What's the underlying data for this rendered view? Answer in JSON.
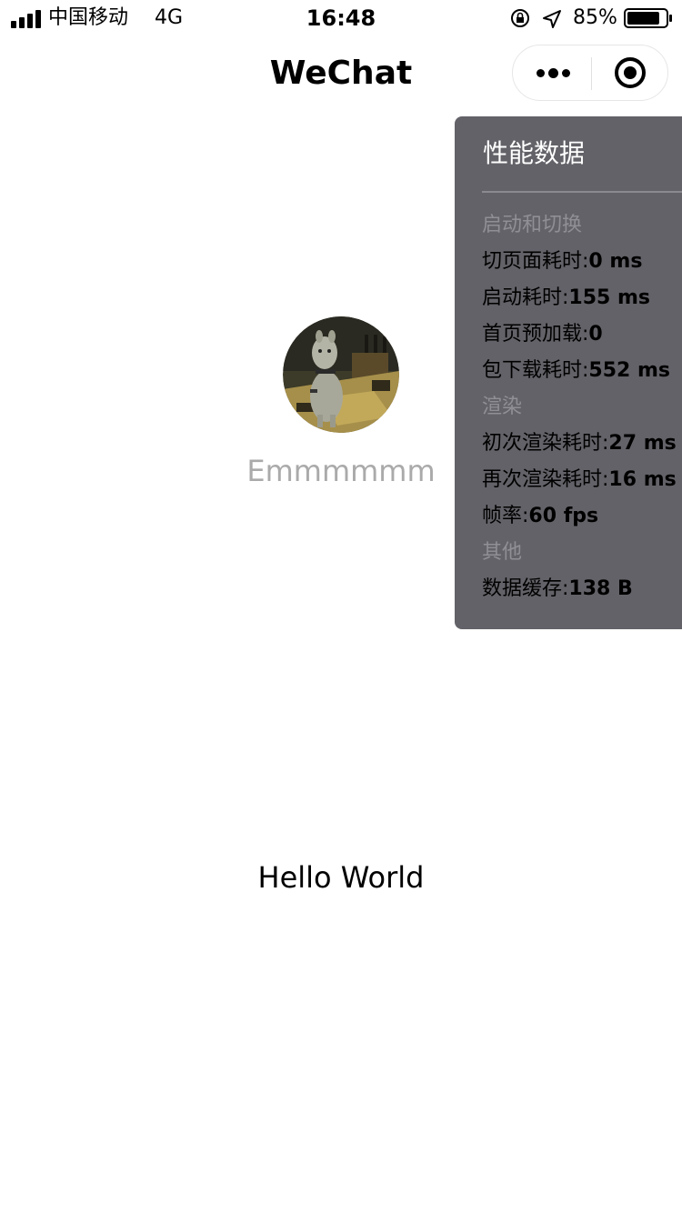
{
  "status_bar": {
    "carrier": "中国移动",
    "network": "4G",
    "time": "16:48",
    "battery_percent": "85%",
    "battery_level": 0.85,
    "icons": [
      "signal-icon",
      "lock-rotation-icon",
      "location-arrow-icon",
      "battery-icon"
    ]
  },
  "nav": {
    "title": "WeChat",
    "more_icon": "more-dots-icon",
    "close_icon": "target-circle-icon"
  },
  "profile": {
    "nickname": "Emmmmmm",
    "avatar": "avatar-image"
  },
  "main": {
    "greeting": "Hello World"
  },
  "perf_panel": {
    "title": "性能数据",
    "sections": [
      {
        "name": "启动和切换",
        "rows": [
          {
            "label": "切页面耗时:",
            "value": "0 ms"
          },
          {
            "label": "启动耗时:",
            "value": "155 ms"
          },
          {
            "label": "首页预加载:",
            "value": "0"
          },
          {
            "label": "包下载耗时:",
            "value": "552 ms"
          }
        ]
      },
      {
        "name": "渲染",
        "rows": [
          {
            "label": "初次渲染耗时:",
            "value": "27 ms"
          },
          {
            "label": "再次渲染耗时:",
            "value": "16 ms"
          },
          {
            "label": "帧率:",
            "value": "60 fps"
          }
        ]
      },
      {
        "name": "其他",
        "rows": [
          {
            "label": "数据缓存:",
            "value": "138 B"
          }
        ]
      }
    ]
  },
  "colors": {
    "panel_bg": "#626268",
    "section_label": "#8f8f95",
    "nickname": "#aaaaaa"
  }
}
